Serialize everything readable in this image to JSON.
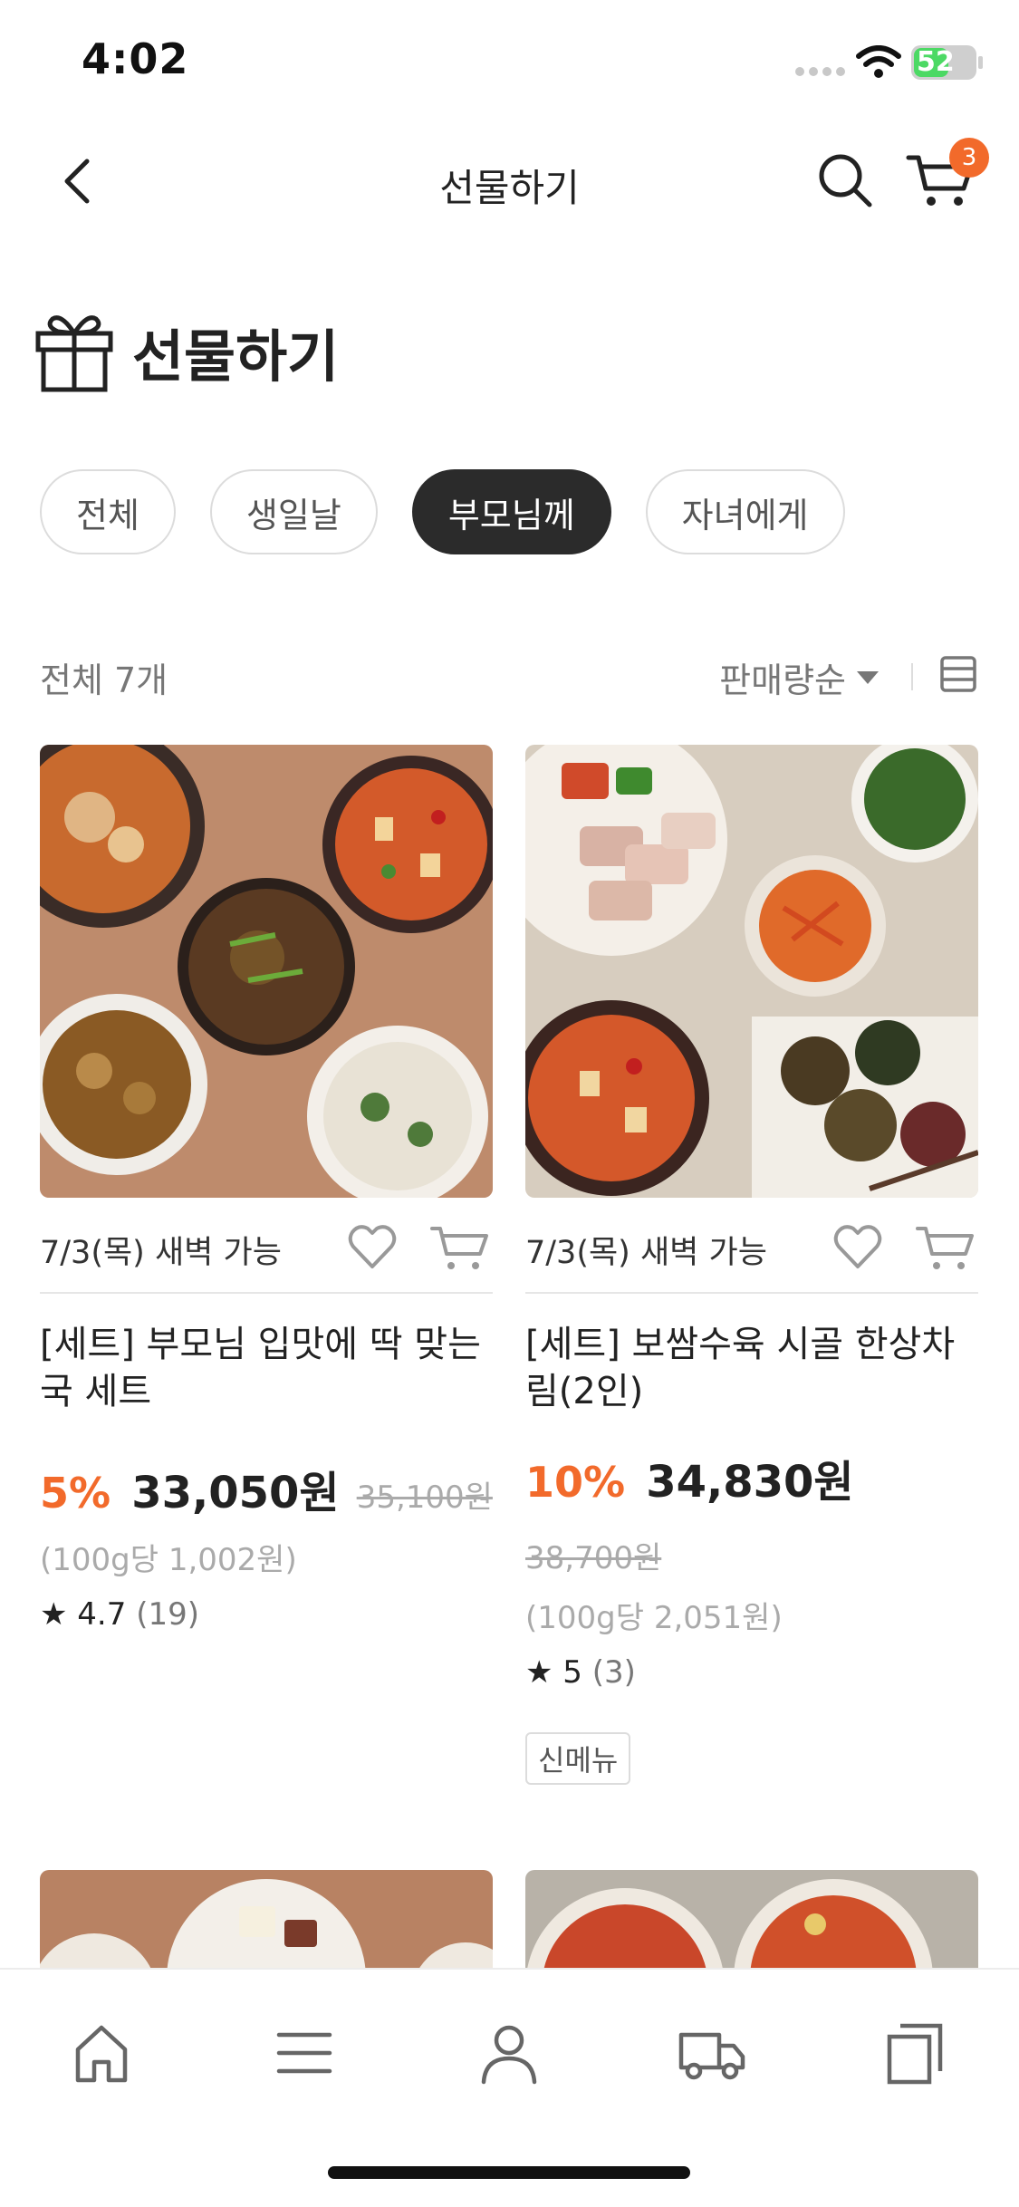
{
  "status_bar": {
    "time": "4:02",
    "battery": "52"
  },
  "header": {
    "title": "선물하기",
    "cart_count": "3"
  },
  "section": {
    "title": "선물하기"
  },
  "chips": [
    {
      "label": "전체",
      "active": false
    },
    {
      "label": "생일날",
      "active": false
    },
    {
      "label": "부모님께",
      "active": true
    },
    {
      "label": "자녀에게",
      "active": false
    }
  ],
  "toolbar": {
    "count": "전체 7개",
    "sort": "판매량순"
  },
  "products": [
    {
      "delivery": "7/3(목) 새벽 가능",
      "name": "[세트] 부모님 입맛에 딱 맞는 국 세트",
      "discount": "5%",
      "price": "33,050원",
      "original_price": "35,100원",
      "unit_price": "(100g당 1,002원)",
      "rating": "4.7",
      "review_count": "(19)",
      "tag": ""
    },
    {
      "delivery": "7/3(목) 새벽 가능",
      "name": "[세트] 보쌈수육 시골 한상차림(2인)",
      "discount": "10%",
      "price": "34,830원",
      "original_price": "38,700원",
      "unit_price": "(100g당 2,051원)",
      "rating": "5",
      "review_count": "(3)",
      "tag": "신메뉴"
    }
  ],
  "colors": {
    "accent": "#f26a2b",
    "dark": "#2b2b2b",
    "muted": "#aaaaaa"
  },
  "tabbar": {
    "icons": [
      "home-icon",
      "menu-icon",
      "person-icon",
      "truck-icon",
      "copy-icon"
    ]
  }
}
